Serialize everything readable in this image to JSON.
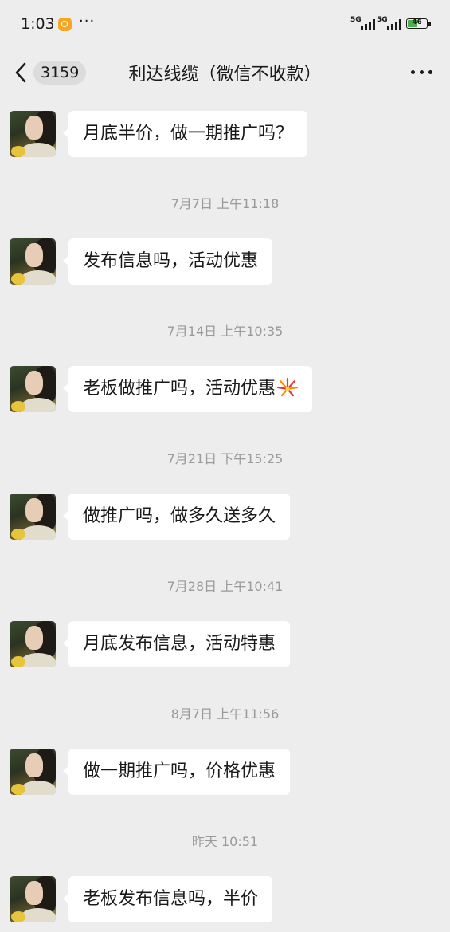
{
  "status": {
    "time": "1:03",
    "more": "···",
    "signal_label_1": "5G",
    "signal_label_2": "5G",
    "battery": "46"
  },
  "nav": {
    "unread_count": "3159",
    "title": "利达线缆（微信不收款）"
  },
  "messages": [
    {
      "text": "月底半价，做一期推广吗？"
    },
    {
      "timestamp": "7月7日 上午11:18",
      "text": "发布信息吗，活动优惠"
    },
    {
      "timestamp": "7月14日 上午10:35",
      "text": "老板做推广吗，活动优惠",
      "emoji": "firework-icon"
    },
    {
      "timestamp": "7月21日 下午15:25",
      "text": "做推广吗，做多久送多久"
    },
    {
      "timestamp": "7月28日 上午10:41",
      "text": "月底发布信息，活动特惠"
    },
    {
      "timestamp": "8月7日 上午11:56",
      "text": "做一期推广吗，价格优惠"
    },
    {
      "timestamp": "昨天 10:51",
      "text": "老板发布信息吗，半价"
    }
  ],
  "colors": {
    "background": "#ededed",
    "bubble": "#ffffff",
    "timestamp": "#9a9a9a",
    "badge": "#dcdcdc"
  }
}
